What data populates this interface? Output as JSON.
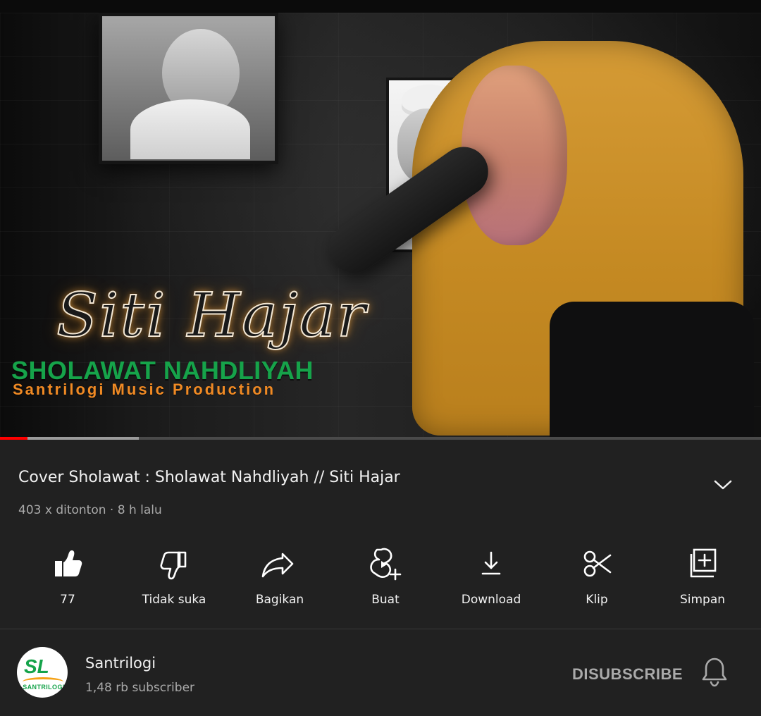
{
  "video": {
    "overlay": {
      "script_title": "Siti Hajar",
      "green_title": "SHOLAWAT NAHDLIYAH",
      "orange_subtitle": "Santrilogi Music Production"
    },
    "progress": {
      "played_percent": 3.6,
      "buffered_percent": 18.2
    }
  },
  "info": {
    "title": "Cover Sholawat : Sholawat Nahdliyah // Siti Hajar",
    "meta": "403 x ditonton · 8 h lalu",
    "expand_icon": "chevron-down-icon"
  },
  "actions": [
    {
      "id": "like",
      "icon": "thumbs-up-filled-icon",
      "label": "77"
    },
    {
      "id": "dislike",
      "icon": "thumbs-down-icon",
      "label": "Tidak suka"
    },
    {
      "id": "share",
      "icon": "share-arrow-icon",
      "label": "Bagikan"
    },
    {
      "id": "create",
      "icon": "create-short-icon",
      "label": "Buat"
    },
    {
      "id": "download",
      "icon": "download-icon",
      "label": "Download"
    },
    {
      "id": "clip",
      "icon": "scissors-icon",
      "label": "Klip"
    },
    {
      "id": "save",
      "icon": "add-to-playlist-icon",
      "label": "Simpan"
    }
  ],
  "channel": {
    "name": "Santrilogi",
    "subscribers": "1,48 rb subscriber",
    "subscribe_label": "DISUBSCRIBE",
    "avatar_logo": {
      "main": "SL",
      "sub": "SANTRILOGI"
    },
    "bell_icon": "bell-icon"
  },
  "colors": {
    "background": "#212121",
    "text_primary": "#f1f1f1",
    "text_secondary": "#aaaaaa",
    "progress_played": "#ff0000",
    "progress_buffer": "#9b9b9b"
  }
}
